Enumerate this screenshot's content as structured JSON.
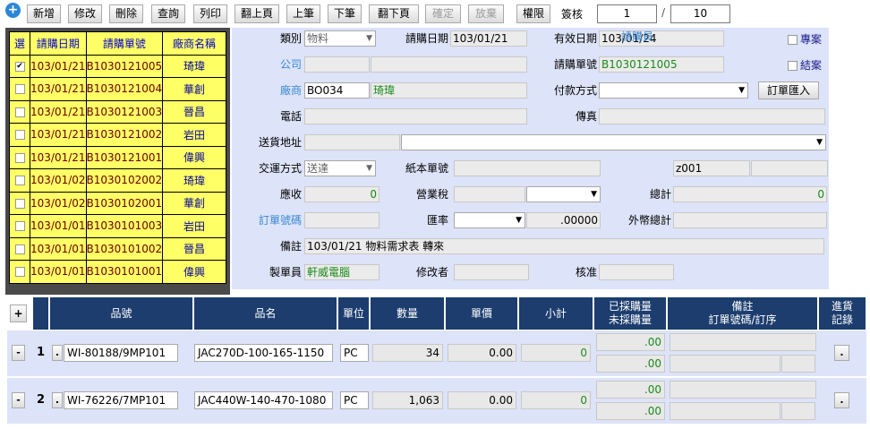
{
  "toolbar": {
    "buttons": [
      "新增",
      "修改",
      "刪除",
      "查詢",
      "列印",
      "翻上頁",
      "上筆",
      "下筆",
      "翻下頁",
      "確定",
      "放棄",
      "權限"
    ],
    "sign_label": "簽核",
    "page_current": "1",
    "page_sep": "/",
    "page_total": "10"
  },
  "list": {
    "headers": [
      "選",
      "請購日期",
      "請購單號",
      "廠商名稱"
    ],
    "rows": [
      {
        "checked": "✔",
        "date": "103/01/21",
        "no": "B1030121005",
        "vendor": "琦瑋"
      },
      {
        "checked": "",
        "date": "103/01/21",
        "no": "B1030121004",
        "vendor": "華創"
      },
      {
        "checked": "",
        "date": "103/01/21",
        "no": "B1030121003",
        "vendor": "晉昌"
      },
      {
        "checked": "",
        "date": "103/01/21",
        "no": "B1030121002",
        "vendor": "岩田"
      },
      {
        "checked": "",
        "date": "103/01/21",
        "no": "B1030121001",
        "vendor": "偉興"
      },
      {
        "checked": "",
        "date": "103/01/02",
        "no": "B1030102002",
        "vendor": "琦瑋"
      },
      {
        "checked": "",
        "date": "103/01/02",
        "no": "B1030102001",
        "vendor": "華創"
      },
      {
        "checked": "",
        "date": "103/01/01",
        "no": "B1030101003",
        "vendor": "岩田"
      },
      {
        "checked": "",
        "date": "103/01/01",
        "no": "B1030101002",
        "vendor": "晉昌"
      },
      {
        "checked": "",
        "date": "103/01/01",
        "no": "B1030101001",
        "vendor": "偉興"
      }
    ]
  },
  "form": {
    "category_label": "類別",
    "category_value": "物料",
    "req_date_label": "請購日期",
    "req_date_value": "103/01/21",
    "valid_date_label": "有效日期",
    "valid_date_value": "103/01/24",
    "special_label": "專案",
    "company_label": "公司",
    "req_no_label": "請購單號",
    "req_no_value": "B1030121005",
    "closed_label": "結案",
    "vendor_label": "廠商",
    "vendor_code": "BO034",
    "vendor_name": "琦瑋",
    "payment_label": "付款方式",
    "import_order_label": "訂單匯入",
    "phone_label": "電話",
    "fax_label": "傳真",
    "ship_addr_label": "送貨地址",
    "delivery_label": "交運方式",
    "delivery_value": "送達",
    "paper_no_label": "紙本單號",
    "requester_label": "請購員",
    "requester_value": "z001",
    "receivable_label": "應收",
    "receivable_value": "0",
    "tax_label": "營業稅",
    "total_label": "總計",
    "total_value": "0",
    "order_no_label": "訂單號碼",
    "rate_label": "匯率",
    "rate_value": ".00000",
    "foreign_total_label": "外幣總計",
    "note_label": "備註",
    "note_value": "103/01/21 物料需求表 轉來",
    "maker_label": "製單員",
    "maker_value": "軒威電腦",
    "modifier_label": "修改者",
    "approver_label": "核准"
  },
  "grid": {
    "add_label": "+",
    "headers": {
      "part_no": "品號",
      "part_name": "品名",
      "unit": "單位",
      "qty": "數量",
      "price": "單價",
      "subtotal": "小計",
      "purchased": "已採購量",
      "unpurchased": "未採購量",
      "note": "備註",
      "order_seq": "訂單號碼/訂序",
      "stock_in": "進貨",
      "stock_record": "記錄"
    },
    "rows": [
      {
        "remove": "-",
        "num": "1",
        "lookup": ".",
        "part_no": "WI-80188/9MP101",
        "part_name": "JAC270D-100-165-1150",
        "unit": "PC",
        "qty": "34",
        "price": "0.00",
        "subtotal": "0",
        "purchased": ".00",
        "unpurchased": ".00",
        "record_btn": "."
      },
      {
        "remove": "-",
        "num": "2",
        "lookup": ".",
        "part_no": "WI-76226/7MP101",
        "part_name": "JAC440W-140-470-1080",
        "unit": "PC",
        "qty": "1,063",
        "price": "0.00",
        "subtotal": "0",
        "purchased": ".00",
        "unpurchased": ".00",
        "record_btn": "."
      }
    ]
  }
}
